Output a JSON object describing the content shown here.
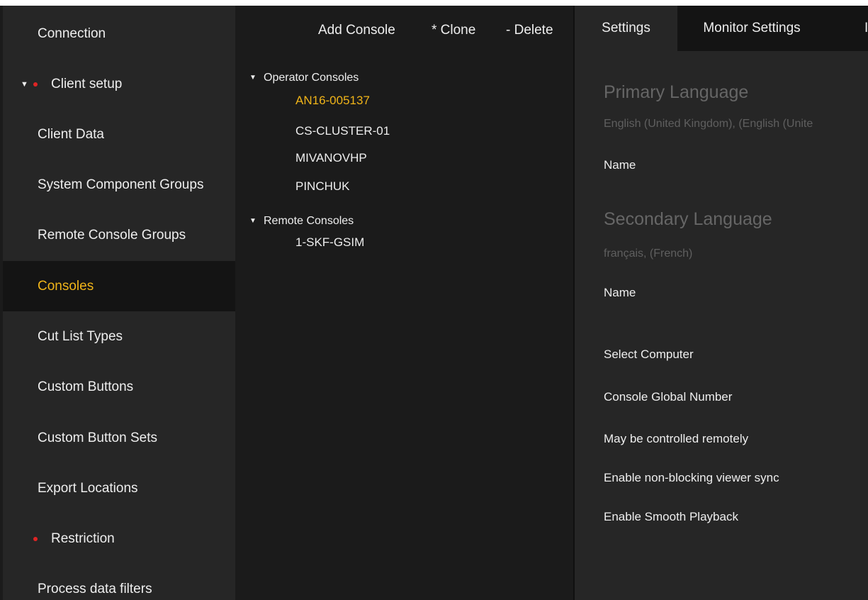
{
  "sidebar": {
    "items": [
      {
        "label": "Connection"
      },
      {
        "label": "Client setup"
      },
      {
        "label": "Client Data"
      },
      {
        "label": "System Component Groups"
      },
      {
        "label": "Remote Console Groups"
      },
      {
        "label": "Consoles"
      },
      {
        "label": "Cut List Types"
      },
      {
        "label": "Custom Buttons"
      },
      {
        "label": "Custom Button Sets"
      },
      {
        "label": "Export Locations"
      },
      {
        "label": "Restriction"
      },
      {
        "label": "Process data filters"
      }
    ],
    "active_index": 5,
    "accent_color": "#f0b419",
    "warning_dot_color": "#e02424"
  },
  "toolbar": {
    "add_label": "Add Console",
    "clone_label": "* Clone",
    "delete_label": "- Delete"
  },
  "tree": {
    "groups": [
      {
        "label": "Operator Consoles",
        "items": [
          "AN16-005137",
          "CS-CLUSTER-01",
          "MIVANOVHP",
          "PINCHUK"
        ]
      },
      {
        "label": "Remote Consoles",
        "items": [
          "1-SKF-GSIM"
        ]
      }
    ],
    "selected_item": "AN16-005137"
  },
  "tabs": [
    {
      "label": "Settings"
    },
    {
      "label": "Monitor Settings"
    },
    {
      "label": "I"
    }
  ],
  "settings": {
    "primary_language_title": "Primary Language",
    "primary_language_value": "English (United Kingdom), (English (Unite",
    "primary_name_label": "Name",
    "secondary_language_title": "Secondary Language",
    "secondary_language_value": "français, (French)",
    "secondary_name_label": "Name",
    "select_computer_label": "Select Computer",
    "console_global_number_label": "Console Global Number",
    "remote_control_label": "May be controlled remotely",
    "non_blocking_sync_label": "Enable non-blocking viewer sync",
    "smooth_playback_label": "Enable Smooth Playback"
  }
}
